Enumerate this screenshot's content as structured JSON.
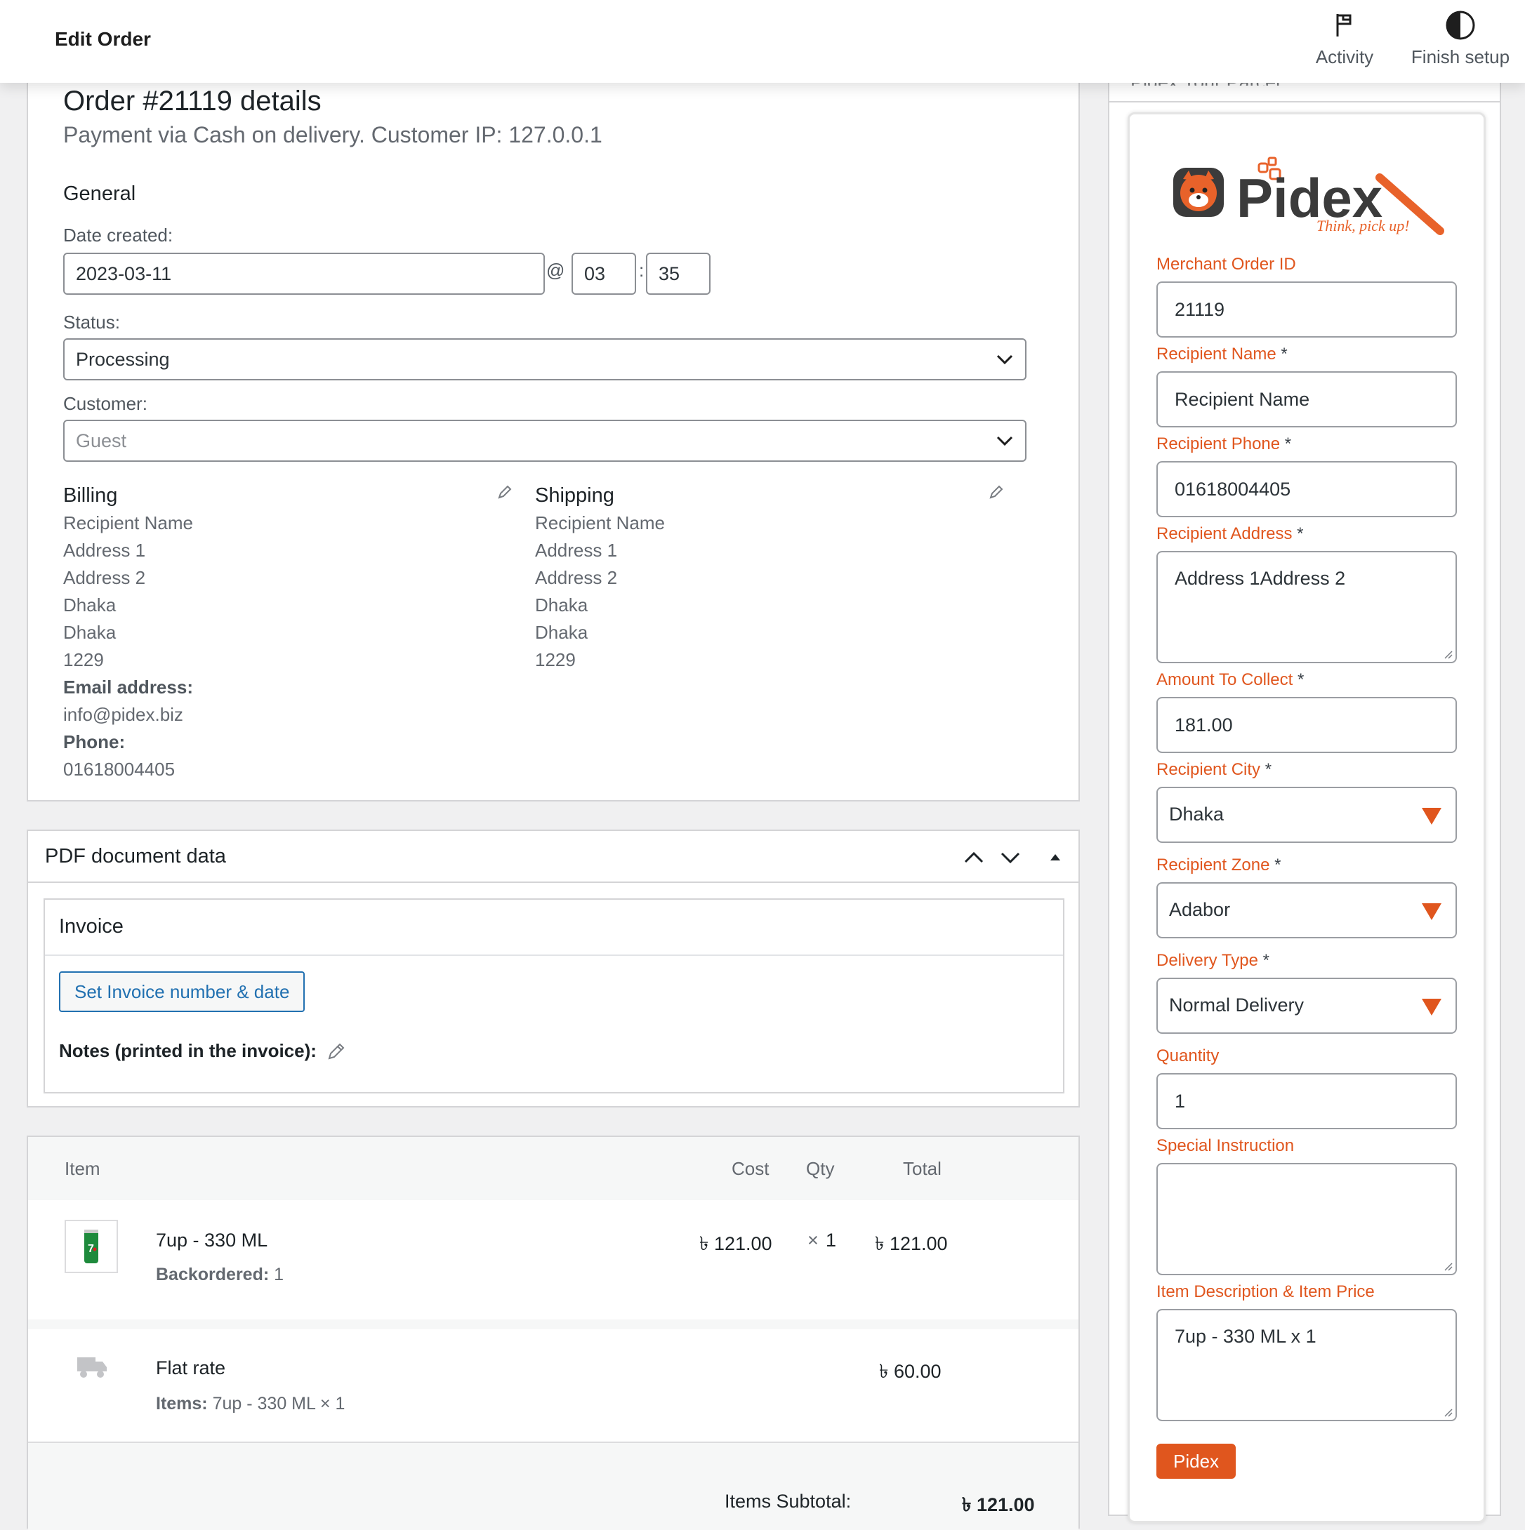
{
  "topbar": {
    "title": "Edit Order",
    "activity_label": "Activity",
    "finish_setup_label": "Finish setup"
  },
  "order": {
    "title": "Order #21119 details",
    "subtitle": "Payment via Cash on delivery. Customer IP: 127.0.0.1",
    "general_heading": "General",
    "date_created_label": "Date created:",
    "date_value": "2023-03-11",
    "at_symbol": "@",
    "hour_value": "03",
    "colon": ":",
    "minute_value": "35",
    "status_label": "Status:",
    "status_value": "Processing",
    "customer_label": "Customer:",
    "customer_value": "Guest"
  },
  "billing": {
    "heading": "Billing",
    "lines": [
      "Recipient Name",
      "Address 1",
      "Address 2",
      "Dhaka",
      "Dhaka",
      "1229"
    ],
    "email_label": "Email address:",
    "email_value": "info@pidex.biz",
    "phone_label": "Phone:",
    "phone_value": "01618004405"
  },
  "shipping": {
    "heading": "Shipping",
    "lines": [
      "Recipient Name",
      "Address 1",
      "Address 2",
      "Dhaka",
      "Dhaka",
      "1229"
    ]
  },
  "pdf": {
    "heading": "PDF document data",
    "invoice_heading": "Invoice",
    "set_invoice_button": "Set Invoice number & date",
    "notes_label": "Notes (printed in the invoice):"
  },
  "items": {
    "headers": {
      "item": "Item",
      "cost": "Cost",
      "qty": "Qty",
      "total": "Total"
    },
    "product": {
      "name": "7up - 330 ML",
      "backordered_label": "Backordered:",
      "backordered_value": "1",
      "cost": "৳ 121.00",
      "qty_prefix": "×",
      "qty": "1",
      "total": "৳ 121.00"
    },
    "shipping_line": {
      "name": "Flat rate",
      "items_label": "Items:",
      "items_value": "7up - 330 ML × 1",
      "total": "৳ 60.00"
    },
    "subtotal_label": "Items Subtotal:",
    "subtotal_value": "৳ 121.00"
  },
  "sidebar": {
    "header_text": "Pidex Your Parcel",
    "logo_text": "Pidex",
    "logo_tagline": "Think, pick up!",
    "fields": {
      "merchant_order_id_label": "Merchant Order ID",
      "merchant_order_id_value": "21119",
      "recipient_name_label": "Recipient Name",
      "recipient_name_value": "Recipient Name",
      "recipient_phone_label": "Recipient Phone",
      "recipient_phone_value": "01618004405",
      "recipient_address_label": "Recipient Address",
      "recipient_address_value": "Address 1Address 2",
      "amount_label": "Amount To Collect",
      "amount_value": "181.00",
      "city_label": "Recipient City",
      "city_value": "Dhaka",
      "zone_label": "Recipient Zone",
      "zone_value": "Adabor",
      "delivery_type_label": "Delivery Type",
      "delivery_type_value": "Normal Delivery",
      "quantity_label": "Quantity",
      "quantity_value": "1",
      "special_instruction_label": "Special Instruction",
      "special_instruction_value": "",
      "item_desc_label": "Item Description & Item Price",
      "item_desc_value": "7up - 330 ML x 1"
    },
    "required_marker": "*",
    "submit_button": "Pidex"
  },
  "colors": {
    "accent_orange": "#e0561e",
    "wp_blue": "#2271b1",
    "border": "#d4d4d6"
  }
}
